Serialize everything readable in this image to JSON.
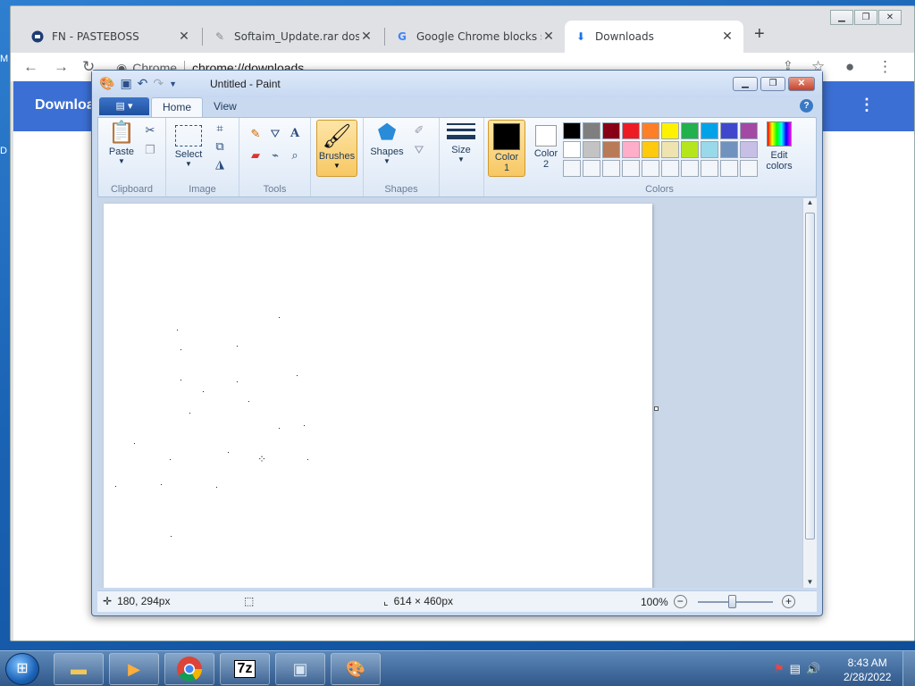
{
  "desktop": {
    "left_glyph_1": "M",
    "left_glyph_2": "D"
  },
  "chrome": {
    "tabs": [
      {
        "title": "FN - PASTEBOSS",
        "icon": "pasteboss-icon"
      },
      {
        "title": "Softaim_Update.rar dosya",
        "icon": "download-page-icon"
      },
      {
        "title": "Google Chrome blocks so",
        "icon": "google-icon"
      },
      {
        "title": "Downloads",
        "icon": "download-icon"
      }
    ],
    "omnibox_site": "Chrome",
    "omnibox_url": "chrome://downloads",
    "page_title": "Downloa"
  },
  "paint": {
    "title": "Untitled - Paint",
    "tabs": {
      "home": "Home",
      "view": "View"
    },
    "groups": {
      "clipboard": "Clipboard",
      "image": "Image",
      "tools": "Tools",
      "shapes": "Shapes",
      "colors": "Colors"
    },
    "buttons": {
      "paste": "Paste",
      "select": "Select",
      "brushes": "Brushes",
      "shapes": "Shapes",
      "size": "Size",
      "color1_a": "Color",
      "color1_b": "1",
      "color2_a": "Color",
      "color2_b": "2",
      "edit_colors_a": "Edit",
      "edit_colors_b": "colors"
    },
    "color1": "#000000",
    "color2": "#ffffff",
    "palette_row1": [
      "#000000",
      "#7f7f7f",
      "#880015",
      "#ed1c24",
      "#ff7f27",
      "#fff200",
      "#22b14c",
      "#00a2e8",
      "#3f48cc",
      "#a349a4"
    ],
    "palette_row2": [
      "#ffffff",
      "#c3c3c3",
      "#b97a57",
      "#ffaec9",
      "#ffc90e",
      "#efe4b0",
      "#b5e61d",
      "#99d9ea",
      "#7092be",
      "#c8bfe7"
    ],
    "status": {
      "cursor_pos": "180, 294px",
      "canvas_size": "614 × 460px",
      "zoom": "100%"
    }
  },
  "taskbar": {
    "apps": [
      "explorer-icon",
      "media-player-icon",
      "chrome-icon",
      "7zip-icon",
      "window-app-icon",
      "paint-icon"
    ],
    "seven_zip_label": "7z",
    "time": "8:43 AM",
    "date": "2/28/2022"
  }
}
